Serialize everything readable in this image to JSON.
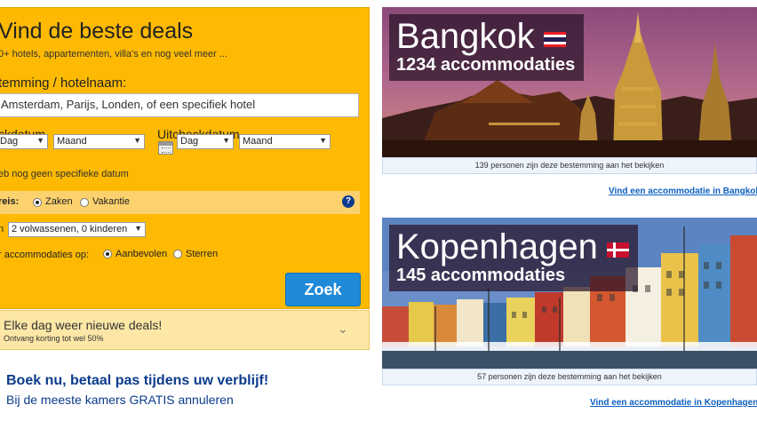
{
  "search": {
    "title": "Vind de beste deals",
    "subtitle": "0+ hotels, appartementen, villa's en nog veel meer ...",
    "destination_label": "temming / hotelnaam:",
    "destination_value": "Amsterdam, Parijs, Londen, of een specifiek hotel",
    "checkin_label": "ckdatum",
    "checkout_label": "Uitcheckdatum",
    "checkin_day": "Dag",
    "checkin_month": "Maand",
    "checkout_day": "Dag",
    "checkout_month": "Maand",
    "no_date_text": "eb nog geen specifieke datum",
    "purpose_label": "reis:",
    "purpose_options": [
      "Zaken",
      "Vakantie"
    ],
    "purpose_selected": "Zaken",
    "guests_prefix": "n",
    "guests_value": "2 volwassenen, 0 kinderen",
    "sort_label": "r accommodaties op:",
    "sort_options": [
      "Aanbevolen",
      "Sterren"
    ],
    "sort_selected": "Aanbevolen",
    "search_button": "Zoek",
    "help_icon_glyph": "?"
  },
  "deals": {
    "title": "Elke dag weer nieuwe deals!",
    "subtitle": "Ontvang korting tot wel 50%"
  },
  "promo": {
    "title": "Boek nu, betaal pas tijdens uw verblijf!",
    "subtitle": "Bij de meeste kamers GRATIS annuleren"
  },
  "destinations": [
    {
      "name": "Bangkok",
      "count": "1234 accommodaties",
      "viewers": "139 personen zijn deze bestemming aan het bekijken",
      "link": "Vind een accommodatie in Bangkok",
      "flag": "thailand-flag"
    },
    {
      "name": "Kopenhagen",
      "count": "145 accommodaties",
      "viewers": "57 personen zijn deze bestemming aan het bekijken",
      "link": "Vind een accommodatie in Kopenhagen",
      "flag": "denmark-flag"
    }
  ],
  "colors": {
    "search_bg": "#feba02",
    "button_blue": "#1e8ad8",
    "link_blue": "#0b5fc2",
    "promo_blue": "#0b3b8c"
  }
}
